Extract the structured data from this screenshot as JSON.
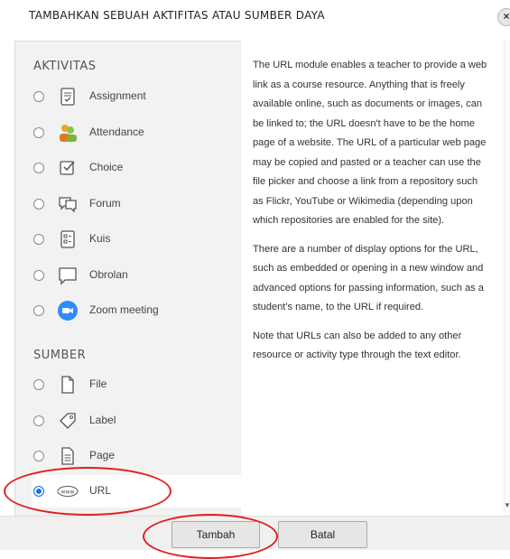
{
  "dialog": {
    "title": "TAMBAHKAN SEBUAH AKTIFITAS ATAU SUMBER DAYA",
    "close_label": "×"
  },
  "sections": {
    "activities_label": "AKTIVITAS",
    "resources_label": "SUMBER"
  },
  "activities": [
    {
      "label": "Assignment",
      "icon": "assignment-icon"
    },
    {
      "label": "Attendance",
      "icon": "attendance-icon"
    },
    {
      "label": "Choice",
      "icon": "choice-icon"
    },
    {
      "label": "Forum",
      "icon": "forum-icon"
    },
    {
      "label": "Kuis",
      "icon": "quiz-icon"
    },
    {
      "label": "Obrolan",
      "icon": "chat-icon"
    },
    {
      "label": "Zoom meeting",
      "icon": "zoom-icon"
    }
  ],
  "resources": [
    {
      "label": "File",
      "icon": "file-icon"
    },
    {
      "label": "Label",
      "icon": "label-icon"
    },
    {
      "label": "Page",
      "icon": "page-icon"
    },
    {
      "label": "URL",
      "icon": "url-icon",
      "selected": true,
      "icon_text": "www"
    }
  ],
  "description": {
    "p1": "The URL module enables a teacher to provide a web link as a course resource. Anything that is freely available online, such as documents or images, can be linked to; the URL doesn't have to be the home page of a website. The URL of a particular web page may be copied and pasted or a teacher can use the file picker and choose a link from a repository such as Flickr, YouTube or Wikimedia (depending upon which repositories are enabled for the site).",
    "p2": "There are a number of display options for the URL, such as embedded or opening in a new window and advanced options for passing information, such as a student's name, to the URL if required.",
    "p3": "Note that URLs can also be added to any other resource or activity type through the text editor."
  },
  "footer": {
    "add_label": "Tambah",
    "cancel_label": "Batal"
  },
  "colors": {
    "selected_radio": "#1a73e8",
    "annotation": "#e02020",
    "zoom_blue": "#2d8cff",
    "attendance_green": "#8bc34a"
  }
}
